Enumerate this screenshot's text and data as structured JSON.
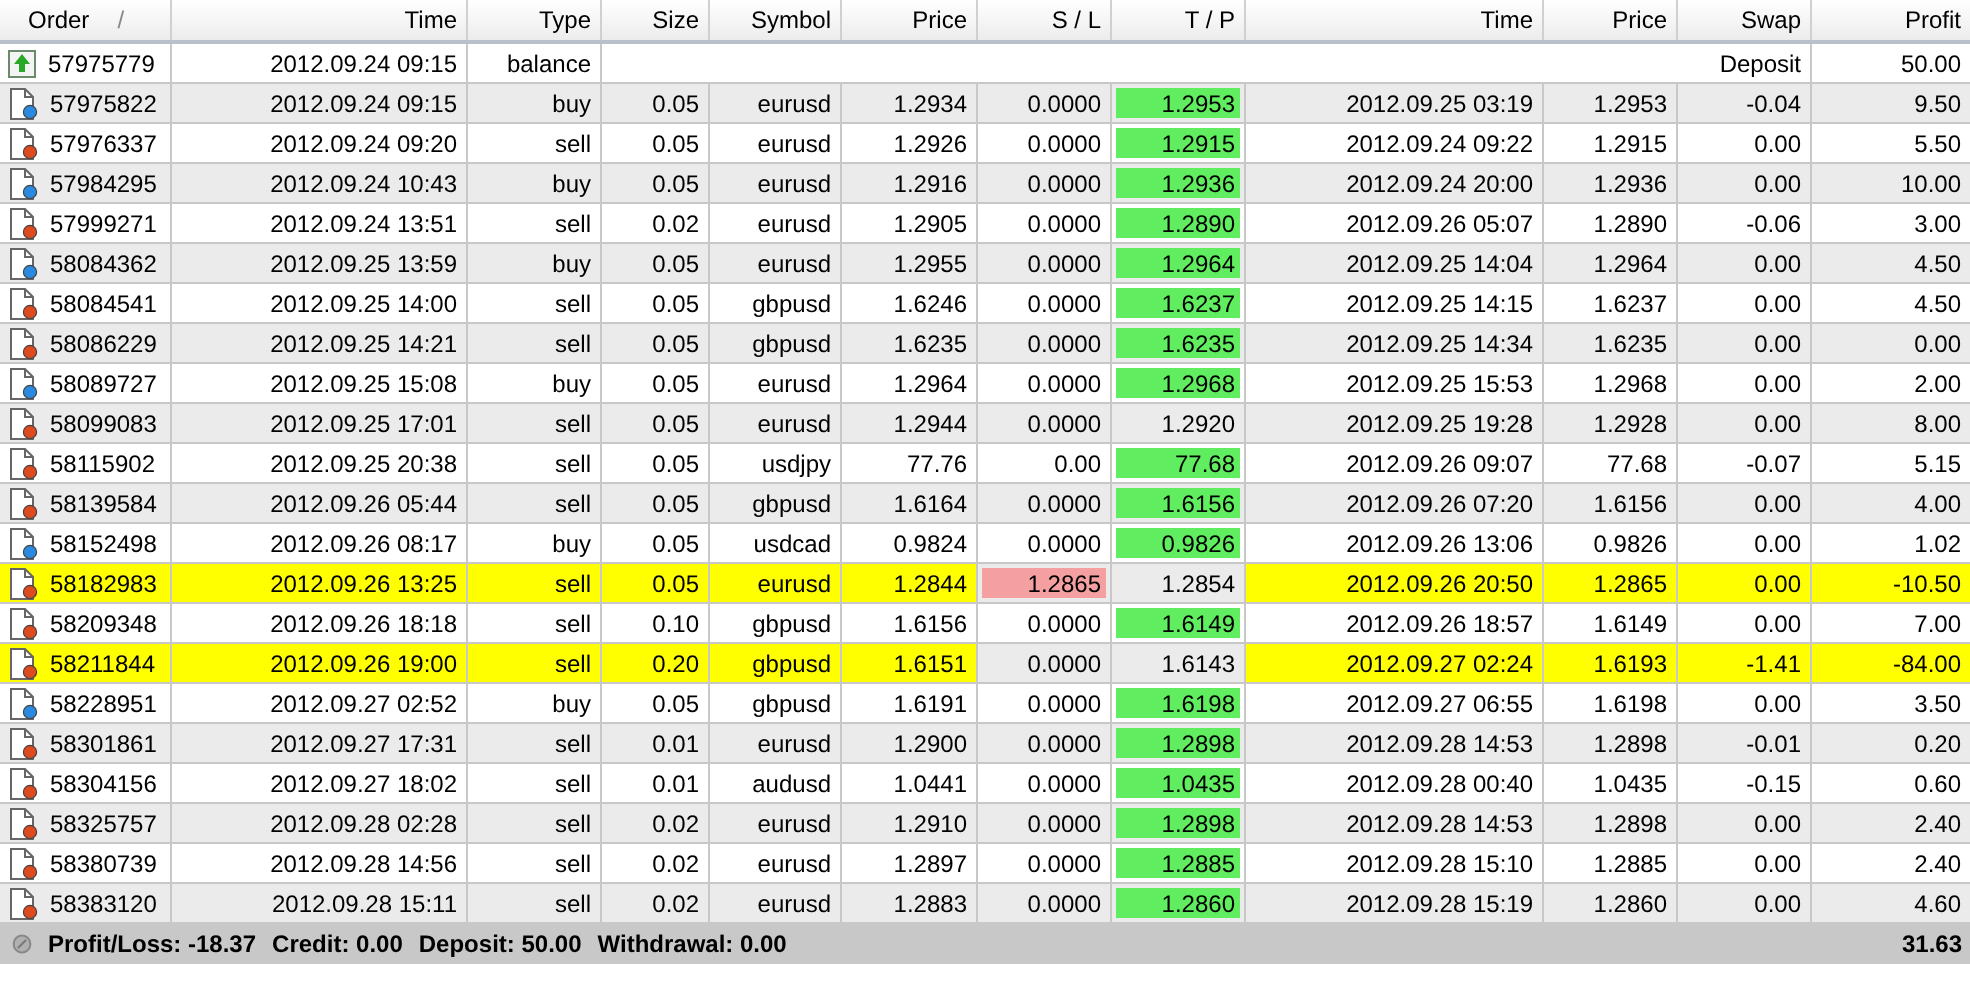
{
  "table": {
    "columns": [
      {
        "label": "Order",
        "sort_mark": "/"
      },
      {
        "label": "Time"
      },
      {
        "label": "Type"
      },
      {
        "label": "Size"
      },
      {
        "label": "Symbol"
      },
      {
        "label": "Price"
      },
      {
        "label": "S / L"
      },
      {
        "label": "T / P"
      },
      {
        "label": "Time"
      },
      {
        "label": "Price"
      },
      {
        "label": "Swap"
      },
      {
        "label": "Profit"
      }
    ],
    "rows": [
      {
        "kind": "balance",
        "order": "57975779",
        "open_time": "2012.09.24 09:15",
        "type": "balance",
        "comment": "Deposit",
        "profit": "50.00"
      },
      {
        "kind": "buy",
        "order": "57975822",
        "open_time": "2012.09.24 09:15",
        "type": "buy",
        "size": "0.05",
        "symbol": "eurusd",
        "price": "1.2934",
        "sl": "0.0000",
        "tp": "1.2953",
        "close_time": "2012.09.25 03:19",
        "close_price": "1.2953",
        "swap": "-0.04",
        "profit": "9.50",
        "highlight": false,
        "sl_hit": false,
        "tp_hit": true
      },
      {
        "kind": "sell",
        "order": "57976337",
        "open_time": "2012.09.24 09:20",
        "type": "sell",
        "size": "0.05",
        "symbol": "eurusd",
        "price": "1.2926",
        "sl": "0.0000",
        "tp": "1.2915",
        "close_time": "2012.09.24 09:22",
        "close_price": "1.2915",
        "swap": "0.00",
        "profit": "5.50",
        "highlight": false,
        "sl_hit": false,
        "tp_hit": true
      },
      {
        "kind": "buy",
        "order": "57984295",
        "open_time": "2012.09.24 10:43",
        "type": "buy",
        "size": "0.05",
        "symbol": "eurusd",
        "price": "1.2916",
        "sl": "0.0000",
        "tp": "1.2936",
        "close_time": "2012.09.24 20:00",
        "close_price": "1.2936",
        "swap": "0.00",
        "profit": "10.00",
        "highlight": false,
        "sl_hit": false,
        "tp_hit": true
      },
      {
        "kind": "sell",
        "order": "57999271",
        "open_time": "2012.09.24 13:51",
        "type": "sell",
        "size": "0.02",
        "symbol": "eurusd",
        "price": "1.2905",
        "sl": "0.0000",
        "tp": "1.2890",
        "close_time": "2012.09.26 05:07",
        "close_price": "1.2890",
        "swap": "-0.06",
        "profit": "3.00",
        "highlight": false,
        "sl_hit": false,
        "tp_hit": true
      },
      {
        "kind": "buy",
        "order": "58084362",
        "open_time": "2012.09.25 13:59",
        "type": "buy",
        "size": "0.05",
        "symbol": "eurusd",
        "price": "1.2955",
        "sl": "0.0000",
        "tp": "1.2964",
        "close_time": "2012.09.25 14:04",
        "close_price": "1.2964",
        "swap": "0.00",
        "profit": "4.50",
        "highlight": false,
        "sl_hit": false,
        "tp_hit": true
      },
      {
        "kind": "sell",
        "order": "58084541",
        "open_time": "2012.09.25 14:00",
        "type": "sell",
        "size": "0.05",
        "symbol": "gbpusd",
        "price": "1.6246",
        "sl": "0.0000",
        "tp": "1.6237",
        "close_time": "2012.09.25 14:15",
        "close_price": "1.6237",
        "swap": "0.00",
        "profit": "4.50",
        "highlight": false,
        "sl_hit": false,
        "tp_hit": true
      },
      {
        "kind": "sell",
        "order": "58086229",
        "open_time": "2012.09.25 14:21",
        "type": "sell",
        "size": "0.05",
        "symbol": "gbpusd",
        "price": "1.6235",
        "sl": "0.0000",
        "tp": "1.6235",
        "close_time": "2012.09.25 14:34",
        "close_price": "1.6235",
        "swap": "0.00",
        "profit": "0.00",
        "highlight": false,
        "sl_hit": false,
        "tp_hit": true
      },
      {
        "kind": "buy",
        "order": "58089727",
        "open_time": "2012.09.25 15:08",
        "type": "buy",
        "size": "0.05",
        "symbol": "eurusd",
        "price": "1.2964",
        "sl": "0.0000",
        "tp": "1.2968",
        "close_time": "2012.09.25 15:53",
        "close_price": "1.2968",
        "swap": "0.00",
        "profit": "2.00",
        "highlight": false,
        "sl_hit": false,
        "tp_hit": true
      },
      {
        "kind": "sell",
        "order": "58099083",
        "open_time": "2012.09.25 17:01",
        "type": "sell",
        "size": "0.05",
        "symbol": "eurusd",
        "price": "1.2944",
        "sl": "0.0000",
        "tp": "1.2920",
        "close_time": "2012.09.25 19:28",
        "close_price": "1.2928",
        "swap": "0.00",
        "profit": "8.00",
        "highlight": false,
        "sl_hit": false,
        "tp_hit": false
      },
      {
        "kind": "sell",
        "order": "58115902",
        "open_time": "2012.09.25 20:38",
        "type": "sell",
        "size": "0.05",
        "symbol": "usdjpy",
        "price": "77.76",
        "sl": "0.00",
        "tp": "77.68",
        "close_time": "2012.09.26 09:07",
        "close_price": "77.68",
        "swap": "-0.07",
        "profit": "5.15",
        "highlight": false,
        "sl_hit": false,
        "tp_hit": true
      },
      {
        "kind": "sell",
        "order": "58139584",
        "open_time": "2012.09.26 05:44",
        "type": "sell",
        "size": "0.05",
        "symbol": "gbpusd",
        "price": "1.6164",
        "sl": "0.0000",
        "tp": "1.6156",
        "close_time": "2012.09.26 07:20",
        "close_price": "1.6156",
        "swap": "0.00",
        "profit": "4.00",
        "highlight": false,
        "sl_hit": false,
        "tp_hit": true
      },
      {
        "kind": "buy",
        "order": "58152498",
        "open_time": "2012.09.26 08:17",
        "type": "buy",
        "size": "0.05",
        "symbol": "usdcad",
        "price": "0.9824",
        "sl": "0.0000",
        "tp": "0.9826",
        "close_time": "2012.09.26 13:06",
        "close_price": "0.9826",
        "swap": "0.00",
        "profit": "1.02",
        "highlight": false,
        "sl_hit": false,
        "tp_hit": true
      },
      {
        "kind": "sell",
        "order": "58182983",
        "open_time": "2012.09.26 13:25",
        "type": "sell",
        "size": "0.05",
        "symbol": "eurusd",
        "price": "1.2844",
        "sl": "1.2865",
        "tp": "1.2854",
        "close_time": "2012.09.26 20:50",
        "close_price": "1.2865",
        "swap": "0.00",
        "profit": "-10.50",
        "highlight": true,
        "sl_hit": true,
        "tp_hit": false
      },
      {
        "kind": "sell",
        "order": "58209348",
        "open_time": "2012.09.26 18:18",
        "type": "sell",
        "size": "0.10",
        "symbol": "gbpusd",
        "price": "1.6156",
        "sl": "0.0000",
        "tp": "1.6149",
        "close_time": "2012.09.26 18:57",
        "close_price": "1.6149",
        "swap": "0.00",
        "profit": "7.00",
        "highlight": false,
        "sl_hit": false,
        "tp_hit": true
      },
      {
        "kind": "sell",
        "order": "58211844",
        "open_time": "2012.09.26 19:00",
        "type": "sell",
        "size": "0.20",
        "symbol": "gbpusd",
        "price": "1.6151",
        "sl": "0.0000",
        "tp": "1.6143",
        "close_time": "2012.09.27 02:24",
        "close_price": "1.6193",
        "swap": "-1.41",
        "profit": "-84.00",
        "highlight": true,
        "sl_hit": false,
        "tp_hit": false
      },
      {
        "kind": "buy",
        "order": "58228951",
        "open_time": "2012.09.27 02:52",
        "type": "buy",
        "size": "0.05",
        "symbol": "gbpusd",
        "price": "1.6191",
        "sl": "0.0000",
        "tp": "1.6198",
        "close_time": "2012.09.27 06:55",
        "close_price": "1.6198",
        "swap": "0.00",
        "profit": "3.50",
        "highlight": false,
        "sl_hit": false,
        "tp_hit": true
      },
      {
        "kind": "sell",
        "order": "58301861",
        "open_time": "2012.09.27 17:31",
        "type": "sell",
        "size": "0.01",
        "symbol": "eurusd",
        "price": "1.2900",
        "sl": "0.0000",
        "tp": "1.2898",
        "close_time": "2012.09.28 14:53",
        "close_price": "1.2898",
        "swap": "-0.01",
        "profit": "0.20",
        "highlight": false,
        "sl_hit": false,
        "tp_hit": true
      },
      {
        "kind": "sell",
        "order": "58304156",
        "open_time": "2012.09.27 18:02",
        "type": "sell",
        "size": "0.01",
        "symbol": "audusd",
        "price": "1.0441",
        "sl": "0.0000",
        "tp": "1.0435",
        "close_time": "2012.09.28 00:40",
        "close_price": "1.0435",
        "swap": "-0.15",
        "profit": "0.60",
        "highlight": false,
        "sl_hit": false,
        "tp_hit": true
      },
      {
        "kind": "sell",
        "order": "58325757",
        "open_time": "2012.09.28 02:28",
        "type": "sell",
        "size": "0.02",
        "symbol": "eurusd",
        "price": "1.2910",
        "sl": "0.0000",
        "tp": "1.2898",
        "close_time": "2012.09.28 14:53",
        "close_price": "1.2898",
        "swap": "0.00",
        "profit": "2.40",
        "highlight": false,
        "sl_hit": false,
        "tp_hit": true
      },
      {
        "kind": "sell",
        "order": "58380739",
        "open_time": "2012.09.28 14:56",
        "type": "sell",
        "size": "0.02",
        "symbol": "eurusd",
        "price": "1.2897",
        "sl": "0.0000",
        "tp": "1.2885",
        "close_time": "2012.09.28 15:10",
        "close_price": "1.2885",
        "swap": "0.00",
        "profit": "2.40",
        "highlight": false,
        "sl_hit": false,
        "tp_hit": true
      },
      {
        "kind": "sell",
        "order": "58383120",
        "open_time": "2012.09.28 15:11",
        "type": "sell",
        "size": "0.02",
        "symbol": "eurusd",
        "price": "1.2883",
        "sl": "0.0000",
        "tp": "1.2860",
        "close_time": "2012.09.28 15:19",
        "close_price": "1.2860",
        "swap": "0.00",
        "profit": "4.60",
        "highlight": false,
        "sl_hit": false,
        "tp_hit": true
      }
    ]
  },
  "summary": {
    "items": [
      "Profit/Loss: -18.37",
      "Credit: 0.00",
      "Deposit: 50.00",
      "Withdrawal: 0.00"
    ],
    "total": "31.63"
  }
}
